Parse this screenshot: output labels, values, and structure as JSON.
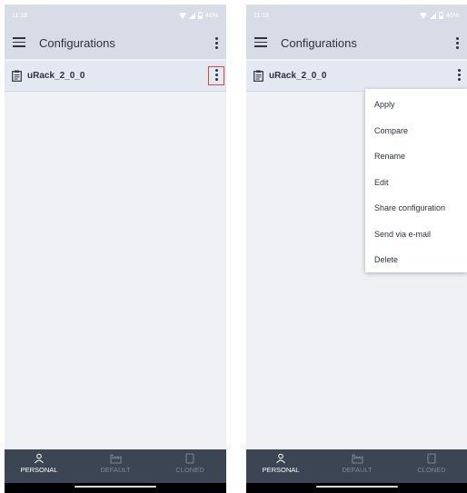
{
  "status_bar": {
    "time": "11:18",
    "battery": "46%"
  },
  "app_bar": {
    "title": "Configurations"
  },
  "config_item": {
    "name": "uRack_2_0_0"
  },
  "context_menu": {
    "items": [
      "Apply",
      "Compare",
      "Rename",
      "Edit",
      "Share configuration",
      "Send via e-mail",
      "Delete"
    ]
  },
  "bottom_nav": {
    "personal": "PERSONAL",
    "default": "DEFAULT",
    "cloned": "CLONED"
  },
  "colors": {
    "app_bar_bg": "#d8dce6",
    "nav_bg": "#3b4554",
    "highlight_border": "#e0443c"
  }
}
